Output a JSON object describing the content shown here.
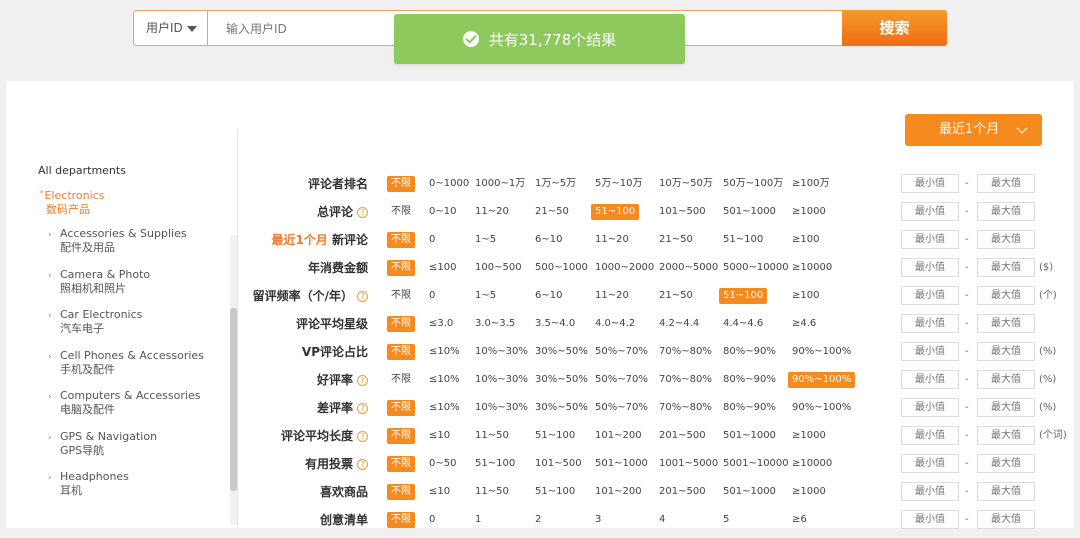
{
  "search": {
    "type_label": "用户ID",
    "placeholder": "输入用户ID",
    "button_label": "搜索"
  },
  "toast": {
    "message": "共有31,778个结果"
  },
  "sidebar": {
    "all_departments": "All departments",
    "current_en": "Electronics",
    "current_zh": "数码产品",
    "categories": [
      {
        "en": "Accessories & Supplies",
        "zh": "配件及用品"
      },
      {
        "en": "Camera & Photo",
        "zh": "照相机和照片"
      },
      {
        "en": "Car Electronics",
        "zh": "汽车电子"
      },
      {
        "en": "Cell Phones & Accessories",
        "zh": "手机及配件"
      },
      {
        "en": "Computers & Accessories",
        "zh": "电脑及配件"
      },
      {
        "en": "GPS & Navigation",
        "zh": "GPS导航"
      },
      {
        "en": "Headphones",
        "zh": "耳机"
      }
    ]
  },
  "period_button": {
    "label": "最近1个月"
  },
  "range_inputs": {
    "min_placeholder": "最小值",
    "max_placeholder": "最大值",
    "separator": "-"
  },
  "filters": [
    {
      "prefix": "",
      "label": "评论者排名",
      "help": false,
      "unit": "",
      "selected": 0,
      "options": [
        "不限",
        "0~1000",
        "1000~1万",
        "1万~5万",
        "5万~10万",
        "10万~50万",
        "50万~100万",
        "≥100万"
      ]
    },
    {
      "prefix": "",
      "label": "总评论",
      "help": true,
      "unit": "",
      "selected": 4,
      "options": [
        "不限",
        "0~10",
        "11~20",
        "21~50",
        "51~100",
        "101~500",
        "501~1000",
        "≥1000"
      ]
    },
    {
      "prefix": "最近1个月",
      "label": "新评论",
      "help": false,
      "unit": "",
      "selected": 0,
      "options": [
        "不限",
        "0",
        "1~5",
        "6~10",
        "11~20",
        "21~50",
        "51~100",
        "≥100"
      ]
    },
    {
      "prefix": "",
      "label": "年消费金额",
      "help": false,
      "unit": "($)",
      "selected": 0,
      "options": [
        "不限",
        "≤100",
        "100~500",
        "500~1000",
        "1000~2000",
        "2000~5000",
        "5000~10000",
        "≥10000"
      ]
    },
    {
      "prefix": "",
      "label": "留评频率（个/年）",
      "help": true,
      "unit": "(个)",
      "selected": 6,
      "options": [
        "不限",
        "0",
        "1~5",
        "6~10",
        "11~20",
        "21~50",
        "51~100",
        "≥100"
      ]
    },
    {
      "prefix": "",
      "label": "评论平均星级",
      "help": false,
      "unit": "",
      "selected": 0,
      "options": [
        "不限",
        "≤3.0",
        "3.0~3.5",
        "3.5~4.0",
        "4.0~4.2",
        "4.2~4.4",
        "4.4~4.6",
        "≥4.6"
      ]
    },
    {
      "prefix": "",
      "label": "VP评论占比",
      "help": false,
      "unit": "(%)",
      "selected": 0,
      "options": [
        "不限",
        "≤10%",
        "10%~30%",
        "30%~50%",
        "50%~70%",
        "70%~80%",
        "80%~90%",
        "90%~100%"
      ]
    },
    {
      "prefix": "",
      "label": "好评率",
      "help": true,
      "unit": "(%)",
      "selected": 7,
      "options": [
        "不限",
        "≤10%",
        "10%~30%",
        "30%~50%",
        "50%~70%",
        "70%~80%",
        "80%~90%",
        "90%~100%"
      ]
    },
    {
      "prefix": "",
      "label": "差评率",
      "help": true,
      "unit": "(%)",
      "selected": 0,
      "options": [
        "不限",
        "≤10%",
        "10%~30%",
        "30%~50%",
        "50%~70%",
        "70%~80%",
        "80%~90%",
        "90%~100%"
      ]
    },
    {
      "prefix": "",
      "label": "评论平均长度",
      "help": true,
      "unit": "(个词)",
      "selected": 0,
      "options": [
        "不限",
        "≤10",
        "11~50",
        "51~100",
        "101~200",
        "201~500",
        "501~1000",
        "≥1000"
      ]
    },
    {
      "prefix": "",
      "label": "有用投票",
      "help": true,
      "unit": "",
      "selected": 0,
      "options": [
        "不限",
        "0~50",
        "51~100",
        "101~500",
        "501~1000",
        "1001~5000",
        "5001~10000",
        "≥10000"
      ]
    },
    {
      "prefix": "",
      "label": "喜欢商品",
      "help": false,
      "unit": "",
      "selected": 0,
      "options": [
        "不限",
        "≤10",
        "11~50",
        "51~100",
        "101~200",
        "201~500",
        "501~1000",
        "≥1000"
      ]
    },
    {
      "prefix": "",
      "label": "创意清单",
      "help": false,
      "unit": "",
      "selected": 0,
      "options": [
        "不限",
        "0",
        "1",
        "2",
        "3",
        "4",
        "5",
        "≥6"
      ]
    }
  ]
}
